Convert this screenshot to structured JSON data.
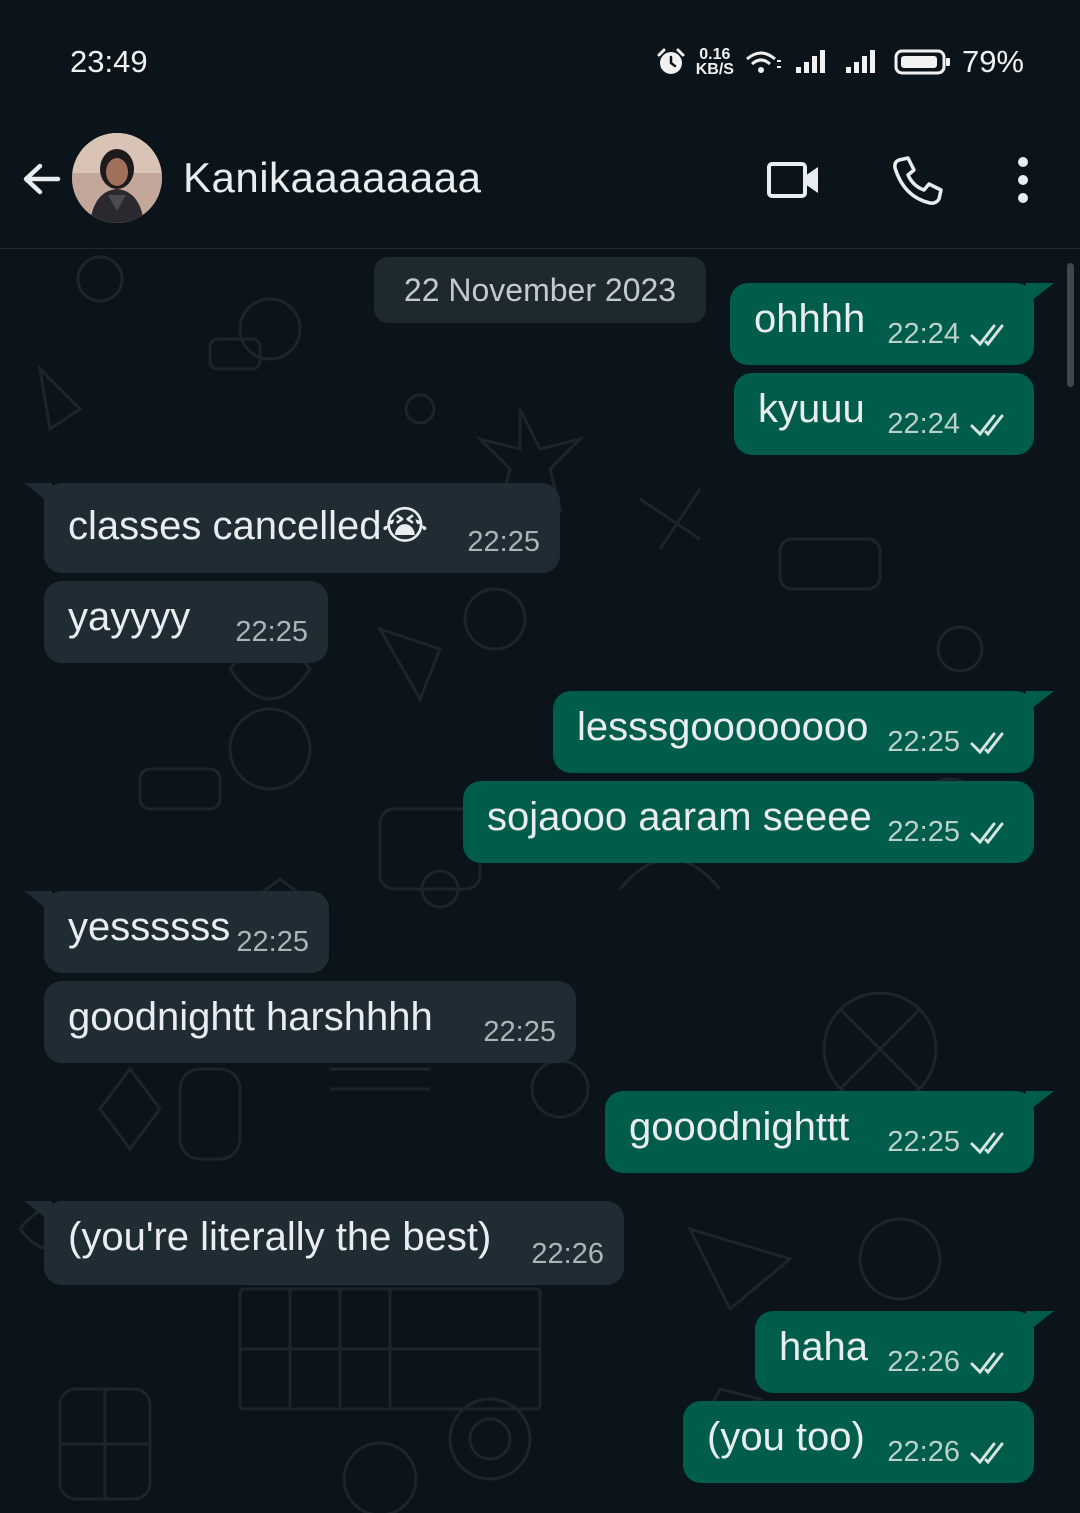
{
  "status": {
    "time": "23:49",
    "speed_value": "0.16",
    "speed_unit": "KB/S",
    "battery": "79%"
  },
  "header": {
    "contact_name": "Kanikaaaaaaaa"
  },
  "chat": {
    "date": "22 November 2023",
    "messages": [
      {
        "dir": "out",
        "text": "ohhhh",
        "time": "22:24"
      },
      {
        "dir": "out",
        "text": "kyuuu",
        "time": "22:24"
      },
      {
        "dir": "in",
        "text": "classes cancelled😭",
        "time": "22:25"
      },
      {
        "dir": "in",
        "text": "yayyyy",
        "time": "22:25"
      },
      {
        "dir": "out",
        "text": "lesssgoooooooo",
        "time": "22:25"
      },
      {
        "dir": "out",
        "text": "sojaooo aaram seeee",
        "time": "22:25"
      },
      {
        "dir": "in",
        "text": "yessssss",
        "time": "22:25"
      },
      {
        "dir": "in",
        "text": "goodnightt harshhhh",
        "time": "22:25"
      },
      {
        "dir": "out",
        "text": "gooodnighttt",
        "time": "22:25"
      },
      {
        "dir": "in",
        "text": "(you're literally the best)",
        "time": "22:26"
      },
      {
        "dir": "out",
        "text": "haha",
        "time": "22:26"
      },
      {
        "dir": "out",
        "text": "(you too)",
        "time": "22:26"
      }
    ]
  },
  "colors": {
    "background": "#0b141a",
    "outgoing": "#005c4b",
    "incoming": "#1f2c33",
    "read_tick": "#d7e6e2"
  },
  "icons": [
    "alarm-icon",
    "wifi-icon",
    "signal-icon",
    "battery-icon",
    "back-arrow-icon",
    "video-call-icon",
    "phone-icon",
    "more-options-icon",
    "double-check-icon"
  ]
}
